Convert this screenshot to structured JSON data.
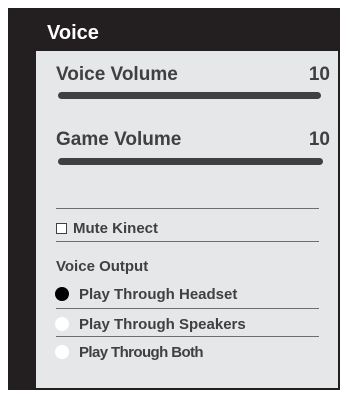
{
  "panel": {
    "title": "Voice"
  },
  "sliders": [
    {
      "label": "Voice Volume",
      "value": "10"
    },
    {
      "label": "Game Volume",
      "value": "10"
    }
  ],
  "mute": {
    "label": "Mute Kinect",
    "checked": false
  },
  "voice_output": {
    "label": "Voice Output",
    "options": [
      {
        "label": "Play Through Headset",
        "selected": true
      },
      {
        "label": "Play Through Speakers",
        "selected": false
      },
      {
        "label": "Play Through Both",
        "selected": false
      }
    ]
  },
  "colors": {
    "panel_background": "#231f20",
    "content_background": "#e6e7e8",
    "text": "#404041",
    "selected_radio": "#000000",
    "unselected_radio": "#ffffff"
  }
}
